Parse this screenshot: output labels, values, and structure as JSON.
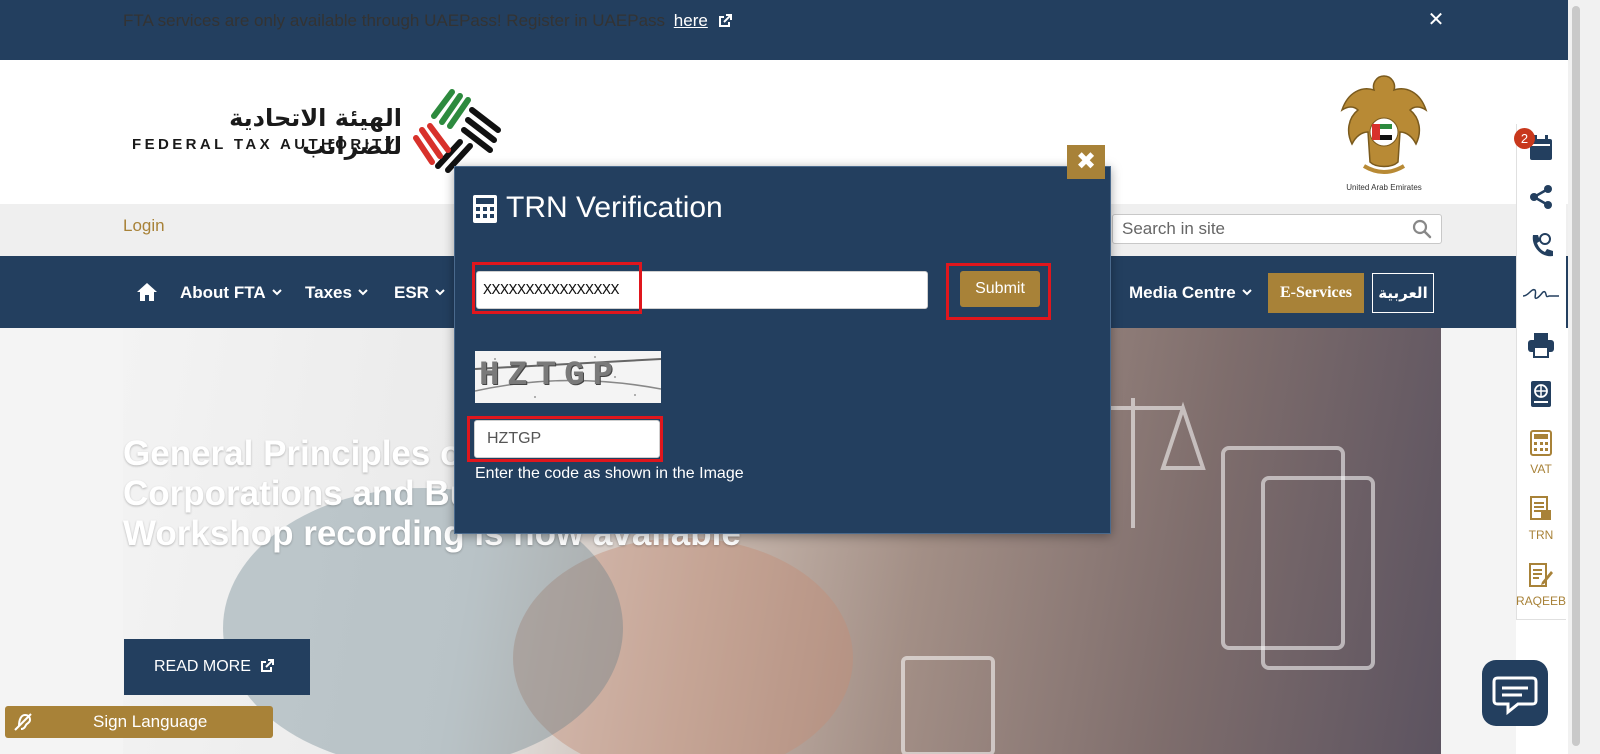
{
  "notice": {
    "text": "FTA services are only available through UAEPass! Register in UAEPass",
    "link_label": "here",
    "close_glyph": "✕"
  },
  "header": {
    "logo_arabic": "الهيئة الاتحادية للضرائب",
    "logo_english": "FEDERAL TAX AUTHORITY",
    "emblem_caption": "United Arab Emirates"
  },
  "utility": {
    "login_label": "Login",
    "search_placeholder": "Search in site"
  },
  "nav": {
    "items": [
      {
        "label": "About FTA"
      },
      {
        "label": "Taxes"
      },
      {
        "label": "ESR"
      },
      {
        "label": "Media Centre"
      }
    ],
    "eservices_label": "E-Services",
    "language_label": "العربية"
  },
  "hero": {
    "heading_line1": "General Principles of",
    "heading_line2": "Corporations and Bus",
    "heading_line3": "Workshop recording is now available",
    "read_more_label": "READ MORE"
  },
  "sign_language": {
    "label": "Sign Language"
  },
  "right_rail": {
    "badge_count": "2",
    "items": [
      {
        "label": "",
        "icon": "calendar-icon"
      },
      {
        "label": "",
        "icon": "share-icon"
      },
      {
        "label": "",
        "icon": "phone-icon"
      },
      {
        "label": "",
        "icon": "signature-icon"
      },
      {
        "label": "",
        "icon": "print-icon"
      },
      {
        "label": "",
        "icon": "globe-book-icon"
      },
      {
        "label": "VAT",
        "icon": "calculator-icon"
      },
      {
        "label": "TRN",
        "icon": "document-icon"
      },
      {
        "label": "RAQEEB",
        "icon": "edit-icon"
      }
    ]
  },
  "modal": {
    "title": "TRN Verification",
    "trn_value": "XXXXXXXXXXXXXXXX",
    "submit_label": "Submit",
    "captcha_image_text": "HZTGP",
    "captcha_value": "HZTGP",
    "captcha_hint": "Enter the code as shown in the Image",
    "close_glyph": "✖"
  },
  "colors": {
    "navy": "#233f5f",
    "gold": "#a88238",
    "highlight_red": "#e0161d"
  }
}
